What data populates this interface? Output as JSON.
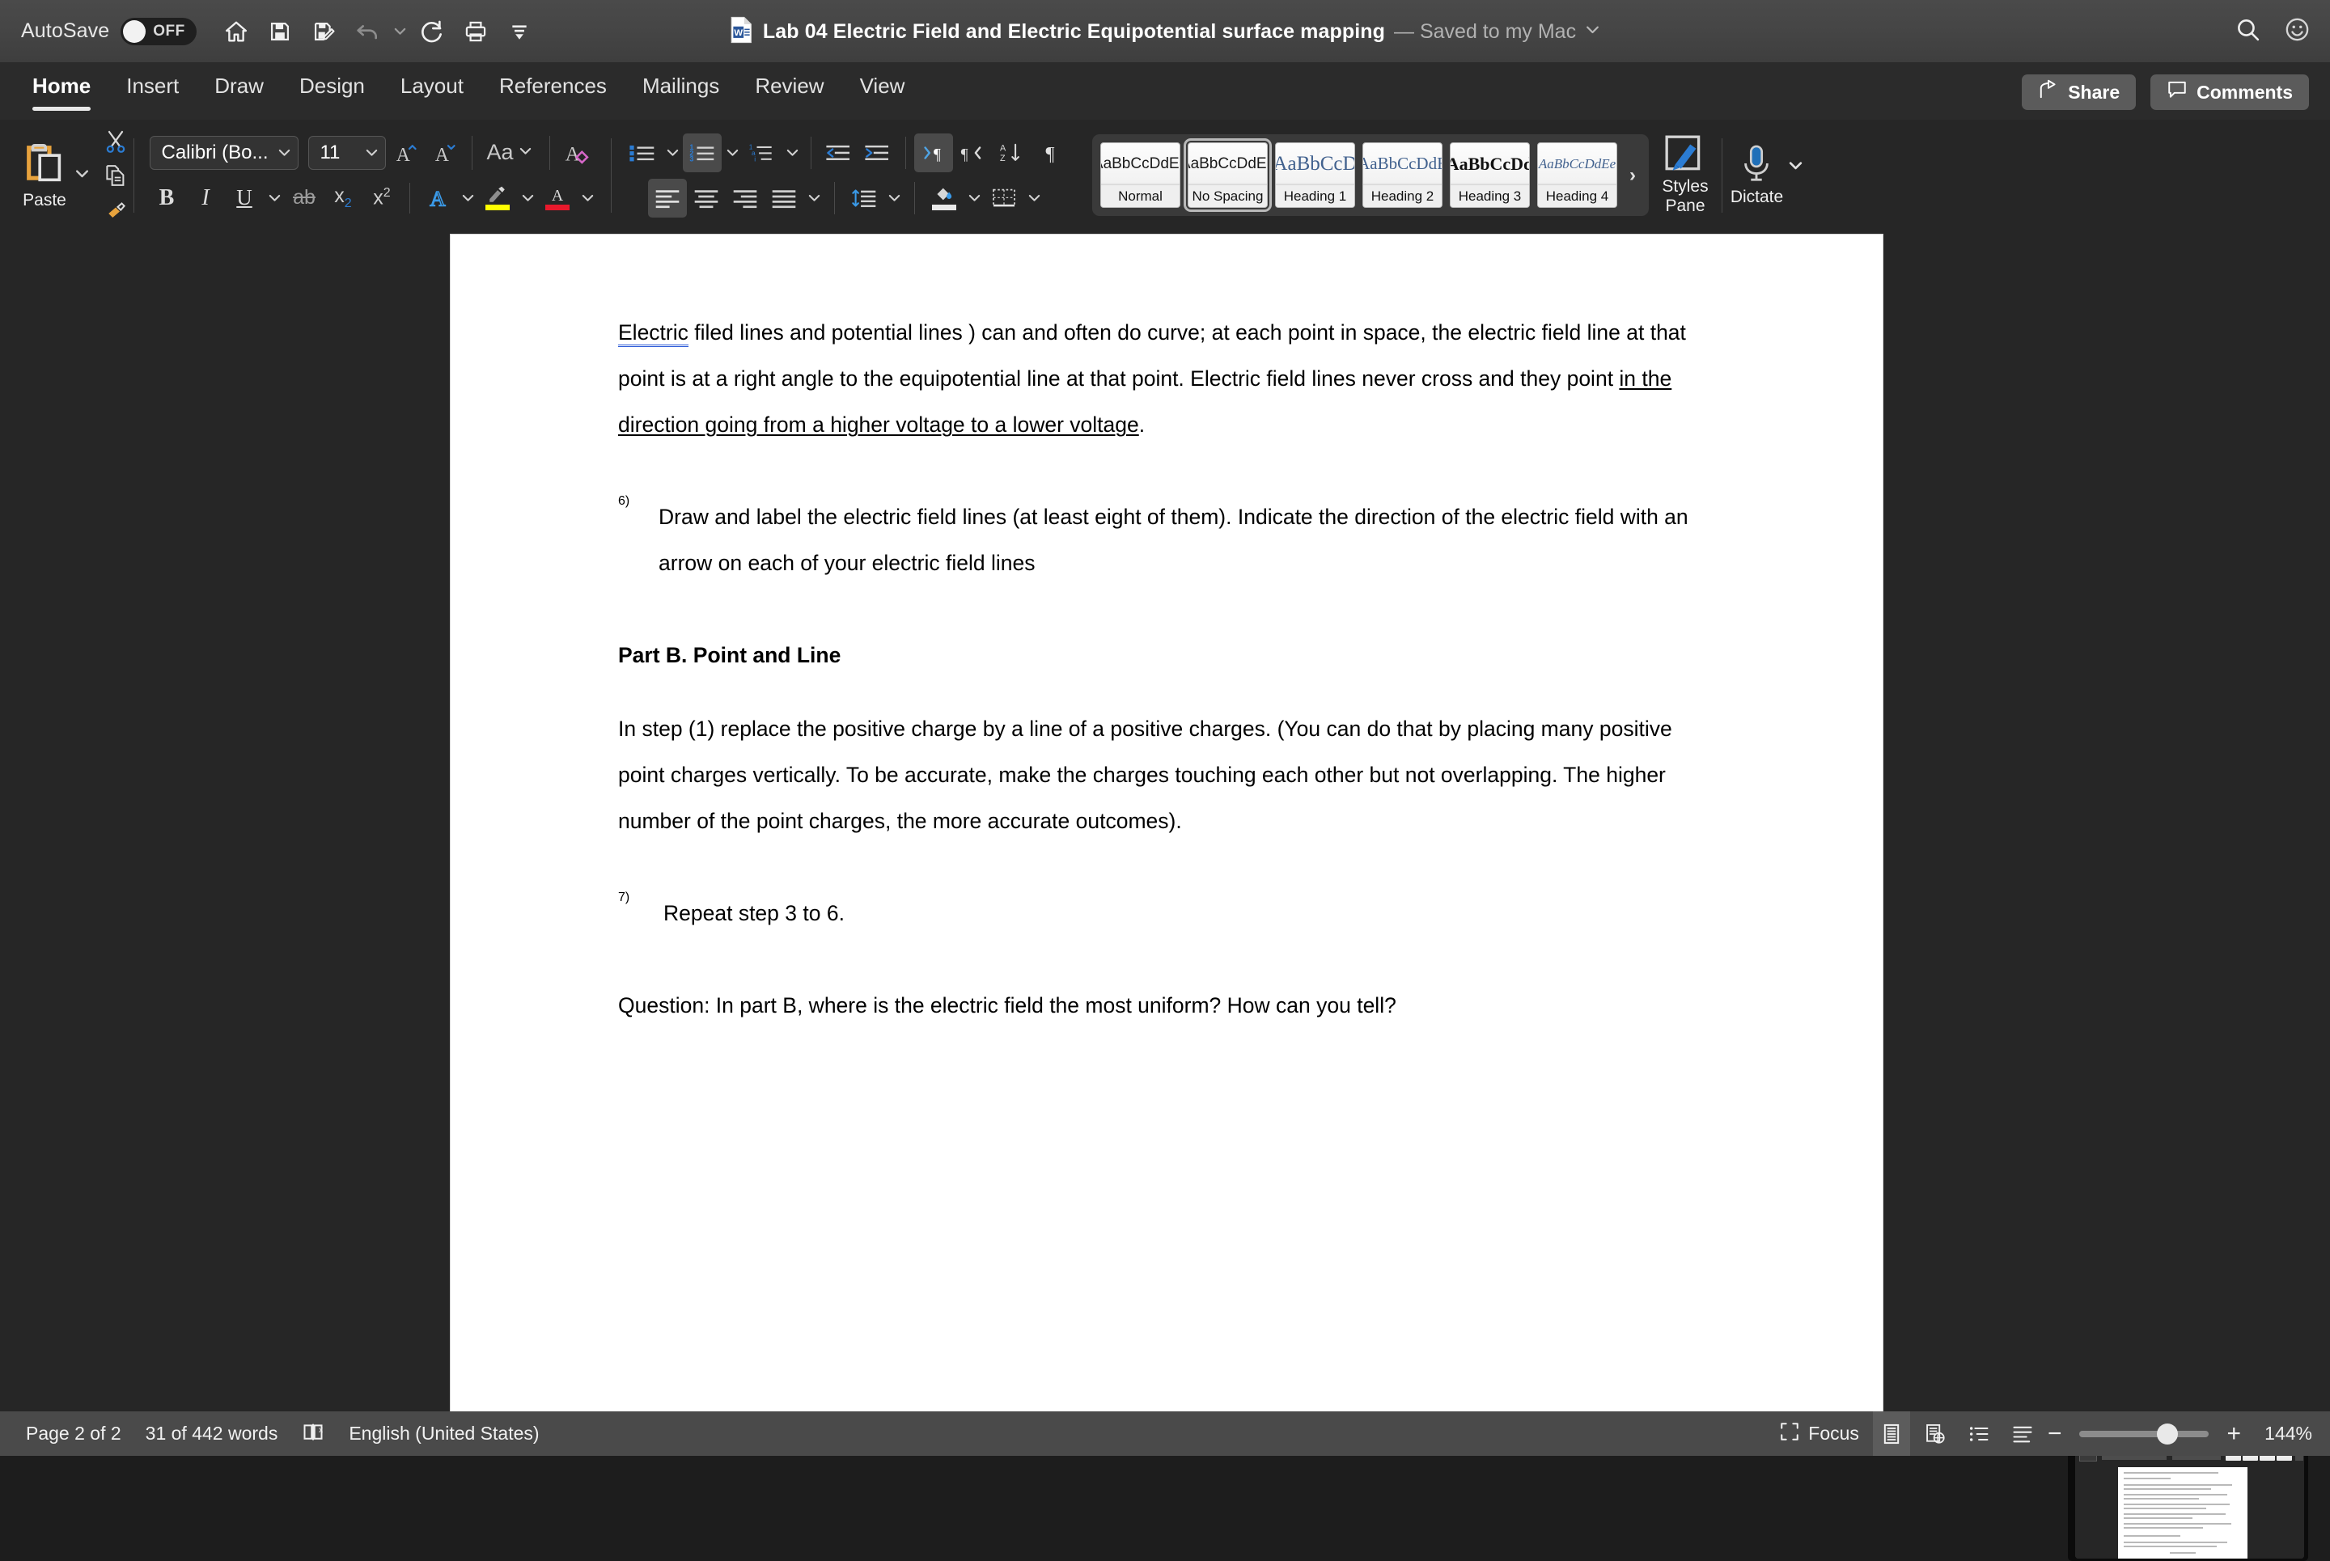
{
  "titlebar": {
    "autosave_label": "AutoSave",
    "autosave_state": "OFF",
    "doc_title": "Lab 04 Electric Field and Electric Equipotential surface mapping",
    "save_status": "— Saved to my Mac",
    "quick_access": [
      {
        "name": "home-icon",
        "label": "Home"
      },
      {
        "name": "save-icon",
        "label": "Save"
      },
      {
        "name": "save-as-icon",
        "label": "Save As"
      },
      {
        "name": "undo-icon",
        "label": "Undo"
      },
      {
        "name": "redo-icon",
        "label": "Redo"
      },
      {
        "name": "print-icon",
        "label": "Print"
      },
      {
        "name": "customize-toolbar-icon",
        "label": "Customize Toolbar"
      }
    ],
    "search_label": "Search",
    "account_label": "Account"
  },
  "ribbon_tabs": [
    {
      "label": "Home",
      "active": true
    },
    {
      "label": "Insert",
      "active": false
    },
    {
      "label": "Draw",
      "active": false
    },
    {
      "label": "Design",
      "active": false
    },
    {
      "label": "Layout",
      "active": false
    },
    {
      "label": "References",
      "active": false
    },
    {
      "label": "Mailings",
      "active": false
    },
    {
      "label": "Review",
      "active": false
    },
    {
      "label": "View",
      "active": false
    }
  ],
  "ribbon_right": {
    "share_label": "Share",
    "comments_label": "Comments"
  },
  "ribbon": {
    "paste_label": "Paste",
    "font_name": "Calibri (Bo...",
    "font_size": "11",
    "bold_label": "B",
    "italic_label": "I",
    "underline_label": "U",
    "strikethrough_label": "ab",
    "subscript_label": "x",
    "subscript_sub": "2",
    "superscript_label": "x",
    "superscript_sup": "2",
    "change_case_label": "Aa",
    "styles_pane_label": "Styles\nPane",
    "styles_pane_line1": "Styles",
    "styles_pane_line2": "Pane",
    "dictate_label": "Dictate",
    "gallery_more": "›",
    "highlight_color": "#ffff00",
    "font_color": "#e8192c",
    "accent_blue": "#2b7cd3"
  },
  "styles": [
    {
      "preview": "AaBbCcDdEe",
      "name": "Normal",
      "selected": false,
      "style": "normal"
    },
    {
      "preview": "AaBbCcDdEe",
      "name": "No Spacing",
      "selected": true,
      "style": "normal"
    },
    {
      "preview": "AaBbCcD",
      "name": "Heading 1",
      "selected": false,
      "style": "h1"
    },
    {
      "preview": "AaBbCcDdE",
      "name": "Heading 2",
      "selected": false,
      "style": "h2"
    },
    {
      "preview": "AaBbCcDd",
      "name": "Heading 3",
      "selected": false,
      "style": "h3"
    },
    {
      "preview": "AaBbCcDdEe",
      "name": "Heading 4",
      "selected": false,
      "style": "h4"
    }
  ],
  "document": {
    "para1_part1": "Electric",
    "para1_part2": " filed lines and potential lines ) can and often do curve; at each point in space, the electric field line at that point is at a right angle to the equipotential line at that point. Electric field lines never cross and they point ",
    "para1_underlined": "in the direction going from a higher voltage to a lower voltage",
    "para1_part3": ".",
    "item6_num": "6)",
    "item6_text": "Draw and label the electric field lines (at least eight of them). Indicate the direction of the electric field with an arrow on each of your electric field lines",
    "partB_heading": "Part B.  Point and Line",
    "para2": "In step (1) replace the positive charge by a line of a positive charges. (You can do that by placing many positive point charges vertically. To be accurate, make the charges touching each other but not overlapping.  The higher number of the point charges, the more accurate outcomes).",
    "item7_num": "7)",
    "item7_text": "Repeat step 3 to 6.",
    "question": "Question: In part B, where is the electric field the most uniform? How can you tell?"
  },
  "statusbar": {
    "page_info": "Page 2 of 2",
    "word_count": "31 of 442 words",
    "proofing_icon_label": "Proofing errors",
    "language": "English (United States)",
    "focus_label": "Focus",
    "views": [
      {
        "name": "print-layout-view",
        "active": true
      },
      {
        "name": "web-layout-view",
        "active": false
      },
      {
        "name": "outline-view",
        "active": false
      },
      {
        "name": "draft-view",
        "active": false
      }
    ],
    "zoom_out": "−",
    "zoom_in": "+",
    "zoom_level": "144%"
  }
}
